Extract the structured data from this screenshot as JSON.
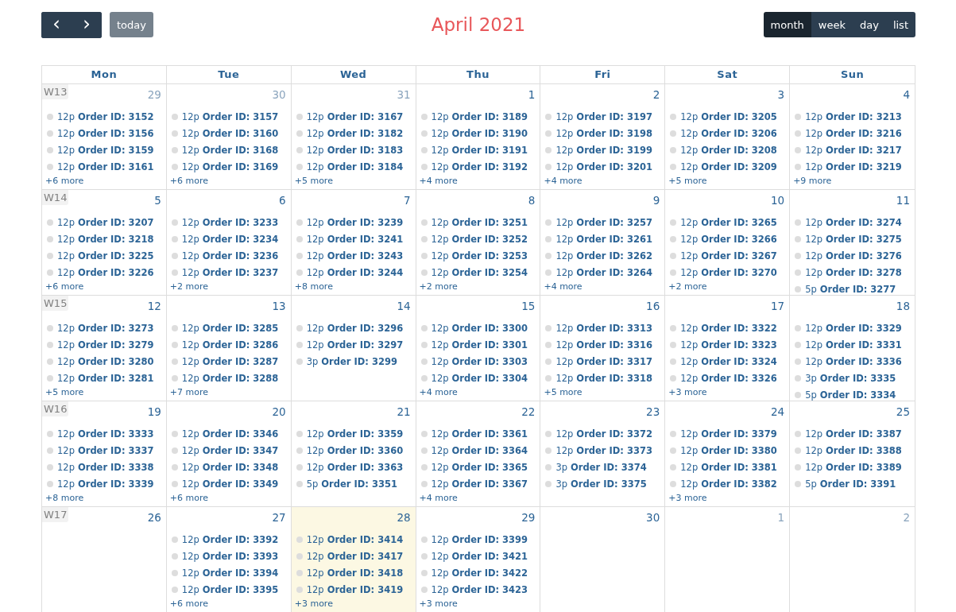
{
  "toolbar": {
    "prev": "‹",
    "next": "›",
    "today": {
      "label": "today",
      "disabled": true
    },
    "title": "April 2021",
    "views": [
      {
        "label": "month",
        "selected": true
      },
      {
        "label": "week",
        "selected": false
      },
      {
        "label": "day",
        "selected": false
      },
      {
        "label": "list",
        "selected": false
      }
    ]
  },
  "weekdays": [
    "Mon",
    "Tue",
    "Wed",
    "Thu",
    "Fri",
    "Sat",
    "Sun"
  ],
  "weeks": [
    {
      "week": "W13",
      "days": [
        {
          "day": "29",
          "other_month": true,
          "today": false,
          "events": [
            {
              "time": "12p",
              "title": "Order ID: 3152"
            },
            {
              "time": "12p",
              "title": "Order ID: 3156"
            },
            {
              "time": "12p",
              "title": "Order ID: 3159"
            },
            {
              "time": "12p",
              "title": "Order ID: 3161"
            }
          ],
          "more": "+6 more"
        },
        {
          "day": "30",
          "other_month": true,
          "today": false,
          "events": [
            {
              "time": "12p",
              "title": "Order ID: 3157"
            },
            {
              "time": "12p",
              "title": "Order ID: 3160"
            },
            {
              "time": "12p",
              "title": "Order ID: 3168"
            },
            {
              "time": "12p",
              "title": "Order ID: 3169"
            }
          ],
          "more": "+6 more"
        },
        {
          "day": "31",
          "other_month": true,
          "today": false,
          "events": [
            {
              "time": "12p",
              "title": "Order ID: 3167"
            },
            {
              "time": "12p",
              "title": "Order ID: 3182"
            },
            {
              "time": "12p",
              "title": "Order ID: 3183"
            },
            {
              "time": "12p",
              "title": "Order ID: 3184"
            }
          ],
          "more": "+5 more"
        },
        {
          "day": "1",
          "other_month": false,
          "today": false,
          "events": [
            {
              "time": "12p",
              "title": "Order ID: 3189"
            },
            {
              "time": "12p",
              "title": "Order ID: 3190"
            },
            {
              "time": "12p",
              "title": "Order ID: 3191"
            },
            {
              "time": "12p",
              "title": "Order ID: 3192"
            }
          ],
          "more": "+4 more"
        },
        {
          "day": "2",
          "other_month": false,
          "today": false,
          "events": [
            {
              "time": "12p",
              "title": "Order ID: 3197"
            },
            {
              "time": "12p",
              "title": "Order ID: 3198"
            },
            {
              "time": "12p",
              "title": "Order ID: 3199"
            },
            {
              "time": "12p",
              "title": "Order ID: 3201"
            }
          ],
          "more": "+4 more"
        },
        {
          "day": "3",
          "other_month": false,
          "today": false,
          "events": [
            {
              "time": "12p",
              "title": "Order ID: 3205"
            },
            {
              "time": "12p",
              "title": "Order ID: 3206"
            },
            {
              "time": "12p",
              "title": "Order ID: 3208"
            },
            {
              "time": "12p",
              "title": "Order ID: 3209"
            }
          ],
          "more": "+5 more"
        },
        {
          "day": "4",
          "other_month": false,
          "today": false,
          "events": [
            {
              "time": "12p",
              "title": "Order ID: 3213"
            },
            {
              "time": "12p",
              "title": "Order ID: 3216"
            },
            {
              "time": "12p",
              "title": "Order ID: 3217"
            },
            {
              "time": "12p",
              "title": "Order ID: 3219"
            }
          ],
          "more": "+9 more"
        }
      ]
    },
    {
      "week": "W14",
      "days": [
        {
          "day": "5",
          "other_month": false,
          "today": false,
          "events": [
            {
              "time": "12p",
              "title": "Order ID: 3207"
            },
            {
              "time": "12p",
              "title": "Order ID: 3218"
            },
            {
              "time": "12p",
              "title": "Order ID: 3225"
            },
            {
              "time": "12p",
              "title": "Order ID: 3226"
            }
          ],
          "more": "+6 more"
        },
        {
          "day": "6",
          "other_month": false,
          "today": false,
          "events": [
            {
              "time": "12p",
              "title": "Order ID: 3233"
            },
            {
              "time": "12p",
              "title": "Order ID: 3234"
            },
            {
              "time": "12p",
              "title": "Order ID: 3236"
            },
            {
              "time": "12p",
              "title": "Order ID: 3237"
            }
          ],
          "more": "+2 more"
        },
        {
          "day": "7",
          "other_month": false,
          "today": false,
          "events": [
            {
              "time": "12p",
              "title": "Order ID: 3239"
            },
            {
              "time": "12p",
              "title": "Order ID: 3241"
            },
            {
              "time": "12p",
              "title": "Order ID: 3243"
            },
            {
              "time": "12p",
              "title": "Order ID: 3244"
            }
          ],
          "more": "+8 more"
        },
        {
          "day": "8",
          "other_month": false,
          "today": false,
          "events": [
            {
              "time": "12p",
              "title": "Order ID: 3251"
            },
            {
              "time": "12p",
              "title": "Order ID: 3252"
            },
            {
              "time": "12p",
              "title": "Order ID: 3253"
            },
            {
              "time": "12p",
              "title": "Order ID: 3254"
            }
          ],
          "more": "+2 more"
        },
        {
          "day": "9",
          "other_month": false,
          "today": false,
          "events": [
            {
              "time": "12p",
              "title": "Order ID: 3257"
            },
            {
              "time": "12p",
              "title": "Order ID: 3261"
            },
            {
              "time": "12p",
              "title": "Order ID: 3262"
            },
            {
              "time": "12p",
              "title": "Order ID: 3264"
            }
          ],
          "more": "+4 more"
        },
        {
          "day": "10",
          "other_month": false,
          "today": false,
          "events": [
            {
              "time": "12p",
              "title": "Order ID: 3265"
            },
            {
              "time": "12p",
              "title": "Order ID: 3266"
            },
            {
              "time": "12p",
              "title": "Order ID: 3267"
            },
            {
              "time": "12p",
              "title": "Order ID: 3270"
            }
          ],
          "more": "+2 more"
        },
        {
          "day": "11",
          "other_month": false,
          "today": false,
          "events": [
            {
              "time": "12p",
              "title": "Order ID: 3274"
            },
            {
              "time": "12p",
              "title": "Order ID: 3275"
            },
            {
              "time": "12p",
              "title": "Order ID: 3276"
            },
            {
              "time": "12p",
              "title": "Order ID: 3278"
            },
            {
              "time": "5p",
              "title": "Order ID: 3277"
            }
          ]
        }
      ]
    },
    {
      "week": "W15",
      "days": [
        {
          "day": "12",
          "other_month": false,
          "today": false,
          "events": [
            {
              "time": "12p",
              "title": "Order ID: 3273"
            },
            {
              "time": "12p",
              "title": "Order ID: 3279"
            },
            {
              "time": "12p",
              "title": "Order ID: 3280"
            },
            {
              "time": "12p",
              "title": "Order ID: 3281"
            }
          ],
          "more": "+5 more"
        },
        {
          "day": "13",
          "other_month": false,
          "today": false,
          "events": [
            {
              "time": "12p",
              "title": "Order ID: 3285"
            },
            {
              "time": "12p",
              "title": "Order ID: 3286"
            },
            {
              "time": "12p",
              "title": "Order ID: 3287"
            },
            {
              "time": "12p",
              "title": "Order ID: 3288"
            }
          ],
          "more": "+7 more"
        },
        {
          "day": "14",
          "other_month": false,
          "today": false,
          "events": [
            {
              "time": "12p",
              "title": "Order ID: 3296"
            },
            {
              "time": "12p",
              "title": "Order ID: 3297"
            },
            {
              "time": "3p",
              "title": "Order ID: 3299"
            }
          ]
        },
        {
          "day": "15",
          "other_month": false,
          "today": false,
          "events": [
            {
              "time": "12p",
              "title": "Order ID: 3300"
            },
            {
              "time": "12p",
              "title": "Order ID: 3301"
            },
            {
              "time": "12p",
              "title": "Order ID: 3303"
            },
            {
              "time": "12p",
              "title": "Order ID: 3304"
            }
          ],
          "more": "+4 more"
        },
        {
          "day": "16",
          "other_month": false,
          "today": false,
          "events": [
            {
              "time": "12p",
              "title": "Order ID: 3313"
            },
            {
              "time": "12p",
              "title": "Order ID: 3316"
            },
            {
              "time": "12p",
              "title": "Order ID: 3317"
            },
            {
              "time": "12p",
              "title": "Order ID: 3318"
            }
          ],
          "more": "+5 more"
        },
        {
          "day": "17",
          "other_month": false,
          "today": false,
          "events": [
            {
              "time": "12p",
              "title": "Order ID: 3322"
            },
            {
              "time": "12p",
              "title": "Order ID: 3323"
            },
            {
              "time": "12p",
              "title": "Order ID: 3324"
            },
            {
              "time": "12p",
              "title": "Order ID: 3326"
            }
          ],
          "more": "+3 more"
        },
        {
          "day": "18",
          "other_month": false,
          "today": false,
          "events": [
            {
              "time": "12p",
              "title": "Order ID: 3329"
            },
            {
              "time": "12p",
              "title": "Order ID: 3331"
            },
            {
              "time": "12p",
              "title": "Order ID: 3336"
            },
            {
              "time": "3p",
              "title": "Order ID: 3335"
            },
            {
              "time": "5p",
              "title": "Order ID: 3334"
            }
          ]
        }
      ]
    },
    {
      "week": "W16",
      "days": [
        {
          "day": "19",
          "other_month": false,
          "today": false,
          "events": [
            {
              "time": "12p",
              "title": "Order ID: 3333"
            },
            {
              "time": "12p",
              "title": "Order ID: 3337"
            },
            {
              "time": "12p",
              "title": "Order ID: 3338"
            },
            {
              "time": "12p",
              "title": "Order ID: 3339"
            }
          ],
          "more": "+8 more"
        },
        {
          "day": "20",
          "other_month": false,
          "today": false,
          "events": [
            {
              "time": "12p",
              "title": "Order ID: 3346"
            },
            {
              "time": "12p",
              "title": "Order ID: 3347"
            },
            {
              "time": "12p",
              "title": "Order ID: 3348"
            },
            {
              "time": "12p",
              "title": "Order ID: 3349"
            }
          ],
          "more": "+6 more"
        },
        {
          "day": "21",
          "other_month": false,
          "today": false,
          "events": [
            {
              "time": "12p",
              "title": "Order ID: 3359"
            },
            {
              "time": "12p",
              "title": "Order ID: 3360"
            },
            {
              "time": "12p",
              "title": "Order ID: 3363"
            },
            {
              "time": "5p",
              "title": "Order ID: 3351"
            }
          ]
        },
        {
          "day": "22",
          "other_month": false,
          "today": false,
          "events": [
            {
              "time": "12p",
              "title": "Order ID: 3361"
            },
            {
              "time": "12p",
              "title": "Order ID: 3364"
            },
            {
              "time": "12p",
              "title": "Order ID: 3365"
            },
            {
              "time": "12p",
              "title": "Order ID: 3367"
            }
          ],
          "more": "+4 more"
        },
        {
          "day": "23",
          "other_month": false,
          "today": false,
          "events": [
            {
              "time": "12p",
              "title": "Order ID: 3372"
            },
            {
              "time": "12p",
              "title": "Order ID: 3373"
            },
            {
              "time": "3p",
              "title": "Order ID: 3374"
            },
            {
              "time": "3p",
              "title": "Order ID: 3375"
            }
          ]
        },
        {
          "day": "24",
          "other_month": false,
          "today": false,
          "events": [
            {
              "time": "12p",
              "title": "Order ID: 3379"
            },
            {
              "time": "12p",
              "title": "Order ID: 3380"
            },
            {
              "time": "12p",
              "title": "Order ID: 3381"
            },
            {
              "time": "12p",
              "title": "Order ID: 3382"
            }
          ],
          "more": "+3 more"
        },
        {
          "day": "25",
          "other_month": false,
          "today": false,
          "events": [
            {
              "time": "12p",
              "title": "Order ID: 3387"
            },
            {
              "time": "12p",
              "title": "Order ID: 3388"
            },
            {
              "time": "12p",
              "title": "Order ID: 3389"
            },
            {
              "time": "5p",
              "title": "Order ID: 3391"
            }
          ]
        }
      ]
    },
    {
      "week": "W17",
      "days": [
        {
          "day": "26",
          "other_month": false,
          "today": false
        },
        {
          "day": "27",
          "other_month": false,
          "today": false,
          "events": [
            {
              "time": "12p",
              "title": "Order ID: 3392"
            },
            {
              "time": "12p",
              "title": "Order ID: 3393"
            },
            {
              "time": "12p",
              "title": "Order ID: 3394"
            },
            {
              "time": "12p",
              "title": "Order ID: 3395"
            }
          ],
          "more": "+6 more"
        },
        {
          "day": "28",
          "other_month": false,
          "today": true,
          "events": [
            {
              "time": "12p",
              "title": "Order ID: 3414"
            },
            {
              "time": "12p",
              "title": "Order ID: 3417"
            },
            {
              "time": "12p",
              "title": "Order ID: 3418"
            },
            {
              "time": "12p",
              "title": "Order ID: 3419"
            }
          ],
          "more": "+3 more"
        },
        {
          "day": "29",
          "other_month": false,
          "today": false,
          "events": [
            {
              "time": "12p",
              "title": "Order ID: 3399"
            },
            {
              "time": "12p",
              "title": "Order ID: 3421"
            },
            {
              "time": "12p",
              "title": "Order ID: 3422"
            },
            {
              "time": "12p",
              "title": "Order ID: 3423"
            }
          ],
          "more": "+3 more"
        },
        {
          "day": "30",
          "other_month": false,
          "today": false
        },
        {
          "day": "1",
          "other_month": true,
          "today": false
        },
        {
          "day": "2",
          "other_month": true,
          "today": false
        }
      ]
    }
  ]
}
